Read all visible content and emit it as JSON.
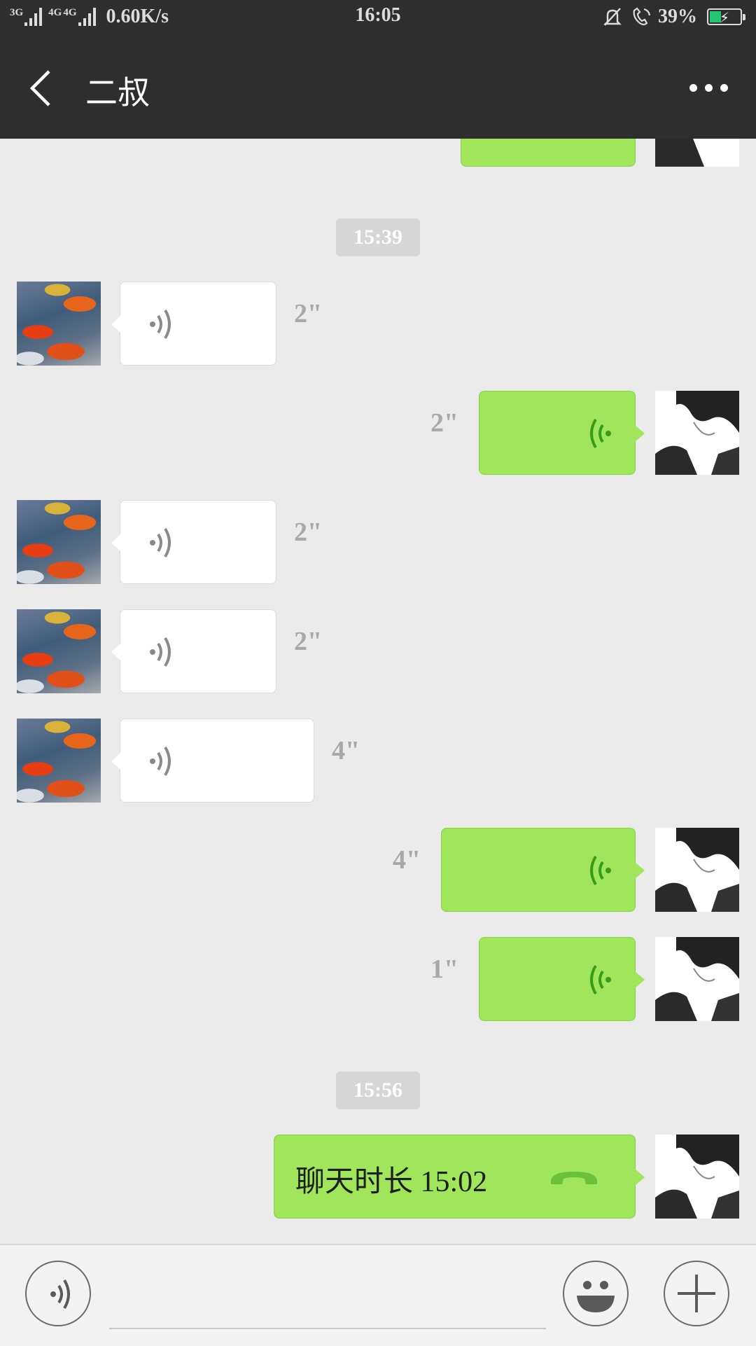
{
  "status_bar": {
    "sim1_network": "3G",
    "sim2_network": "4G",
    "sim2_network_b": "4G",
    "net_speed": "0.60K/s",
    "time": "16:05",
    "battery_percent": "39%",
    "battery_level": 0.39,
    "icons": [
      "signal-icon",
      "signal-icon",
      "mute-bell-icon",
      "wifi-call-icon",
      "battery-charging-icon"
    ]
  },
  "header": {
    "title": "二叔",
    "back_icon": "back-arrow-icon",
    "more_icon": "more-dots-icon"
  },
  "chat": {
    "timestamps": [
      "15:39",
      "15:56"
    ],
    "messages": [
      {
        "from": "me",
        "type": "voice",
        "duration": ""
      },
      {
        "from": "contact",
        "type": "voice",
        "duration": "2\""
      },
      {
        "from": "me",
        "type": "voice",
        "duration": "2\""
      },
      {
        "from": "contact",
        "type": "voice",
        "duration": "2\""
      },
      {
        "from": "contact",
        "type": "voice",
        "duration": "2\""
      },
      {
        "from": "contact",
        "type": "voice",
        "duration": "4\""
      },
      {
        "from": "me",
        "type": "voice",
        "duration": "4\""
      },
      {
        "from": "me",
        "type": "voice",
        "duration": "1\""
      },
      {
        "from": "me",
        "type": "call",
        "text": "聊天时长 15:02"
      }
    ]
  },
  "colors": {
    "header_bg": "#2e2e2e",
    "chat_bg": "#ebebeb",
    "out_bubble": "#9fe65b",
    "in_bubble": "#ffffff",
    "battery_fill": "#23c771"
  },
  "input_bar": {
    "voice_icon": "voice-input-icon",
    "emoji_icon": "emoji-icon",
    "plus_icon": "plus-icon"
  }
}
